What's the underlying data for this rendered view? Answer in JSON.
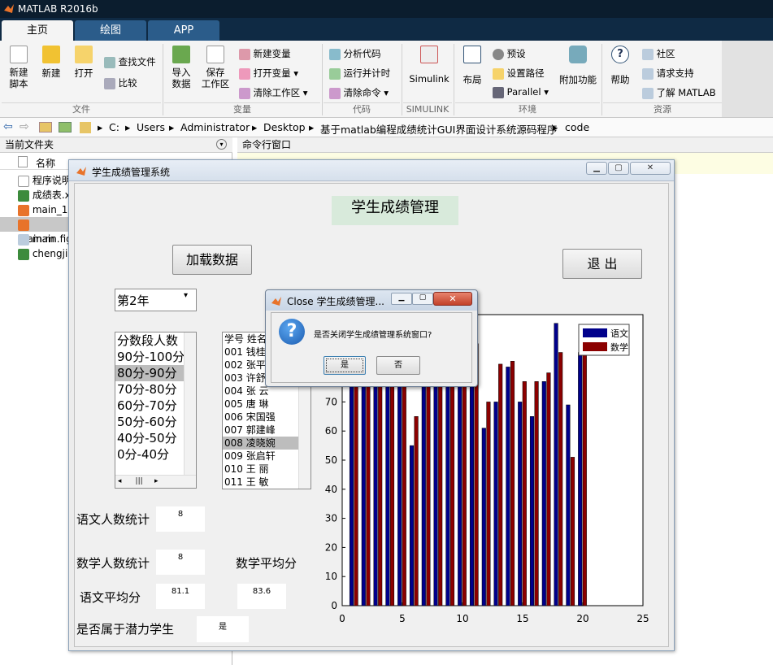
{
  "window": {
    "title": "MATLAB R2016b"
  },
  "tabs": [
    {
      "label": "主页"
    },
    {
      "label": "绘图"
    },
    {
      "label": "APP"
    }
  ],
  "ribbon": {
    "new_script": "新建\n脚本",
    "new": "新建",
    "open": "打开",
    "find_files": "查找文件",
    "compare": "比较",
    "import_data": "导入\n数据",
    "save_workspace": "保存\n工作区",
    "new_variable": "新建变量",
    "open_variable": "打开变量",
    "clear_workspace": "清除工作区",
    "analyze_code": "分析代码",
    "run_and_time": "运行并计时",
    "clear_commands": "清除命令",
    "simulink": "Simulink",
    "layout": "布局",
    "preferences": "预设",
    "set_path": "设置路径",
    "parallel": "Parallel",
    "addons": "附加功能",
    "help": "帮助",
    "community": "社区",
    "request_support": "请求支持",
    "learn_matlab": "了解 MATLAB",
    "sections": [
      "文件",
      "变量",
      "代码",
      "SIMULINK",
      "环境",
      "资源"
    ]
  },
  "address": {
    "crumbs": [
      "C:",
      "Users",
      "Administrator",
      "Desktop",
      "基于matlab编程成绩统计GUI界面设计系统源码程序",
      "code"
    ]
  },
  "left_panel": {
    "title": "当前文件夹",
    "column": "名称",
    "files": [
      "程序说明",
      "成绩表.x",
      "main_1.",
      "main.m",
      "main.fig",
      "chengji"
    ]
  },
  "command_window": {
    "title": "命令行窗口"
  },
  "figure": {
    "title": "学生成绩管理系统",
    "heading": "学生成绩管理",
    "load_button": "加载数据",
    "exit_button": "退 出",
    "year_select": "第2年",
    "ranges": [
      "分数段人数",
      "90分-100分",
      "80分-90分",
      "70分-80分",
      "60分-70分",
      "50分-60分",
      "40分-50分",
      "0分-40分"
    ],
    "ranges_selected": 2,
    "students": [
      "学号  姓名",
      "001  钱桂",
      "002  张平",
      "003  许舒",
      "004  张  云",
      "005  唐  琳",
      "006  宋国强",
      "007  郭建峰",
      "008  凌晓婉",
      "009  张启轩",
      "010  王  丽",
      "011  王  敏"
    ],
    "students_selected": 8,
    "chinese_count_label": "语文人数统计",
    "chinese_count_value": "8",
    "math_count_label": "数学人数统计",
    "math_count_value": "8",
    "math_avg_label": "数学平均分",
    "chinese_avg_label": "语文平均分",
    "chinese_avg_value": "81.1",
    "math_avg_value": "83.6",
    "potential_label": "是否属于潜力学生",
    "potential_value": "是"
  },
  "dialog": {
    "title": "Close 学生成绩管理...",
    "message": "是否关闭学生成绩管理系统窗口?",
    "yes": "是",
    "no": "否"
  },
  "chart_data": {
    "type": "bar",
    "xlim": [
      0,
      25
    ],
    "ylim": [
      0,
      100
    ],
    "xticks": [
      "0",
      "5",
      "10",
      "15",
      "20",
      "25"
    ],
    "yticks": [
      "0",
      "10",
      "20",
      "30",
      "40",
      "50",
      "60",
      "70"
    ],
    "x": [
      1,
      2,
      3,
      4,
      5,
      6,
      7,
      8,
      9,
      10,
      11,
      12,
      13,
      14,
      15,
      16,
      17,
      18,
      19,
      20
    ],
    "series": [
      {
        "name": "语文",
        "color": "#00008b",
        "values": [
          88,
          85,
          80,
          82,
          78,
          55,
          85,
          82,
          86,
          80,
          92,
          61,
          70,
          82,
          70,
          65,
          77,
          97,
          69,
          87
        ]
      },
      {
        "name": "数学",
        "color": "#8b0000",
        "values": [
          90,
          88,
          86,
          85,
          82,
          65,
          80,
          86,
          88,
          88,
          90,
          70,
          83,
          84,
          77,
          77,
          80,
          87,
          51,
          90
        ]
      }
    ],
    "legend": "top-right"
  }
}
